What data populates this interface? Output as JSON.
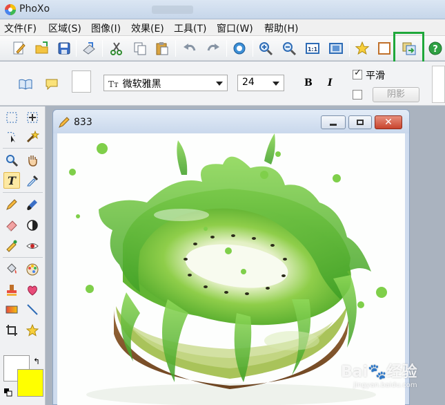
{
  "app": {
    "title": "PhoXo"
  },
  "menu": [
    "文件(F)",
    "区域(S)",
    "图像(I)",
    "效果(E)",
    "工具(T)",
    "窗口(W)",
    "帮助(H)"
  ],
  "props": {
    "font_name": "微软雅黑",
    "font_size": "24",
    "bold_label": "B",
    "italic_label": "I",
    "smooth_label": "平滑",
    "smooth_checked": true,
    "shadow_label": "阴影",
    "shadow_checked": false
  },
  "document": {
    "name": "833"
  },
  "colors": {
    "foreground": "#ffffff",
    "background": "#ffff00",
    "highlight": "#1fa83b"
  },
  "watermark": {
    "brand": "Bai🐾经验",
    "url": "jingyan.baidu.com"
  }
}
